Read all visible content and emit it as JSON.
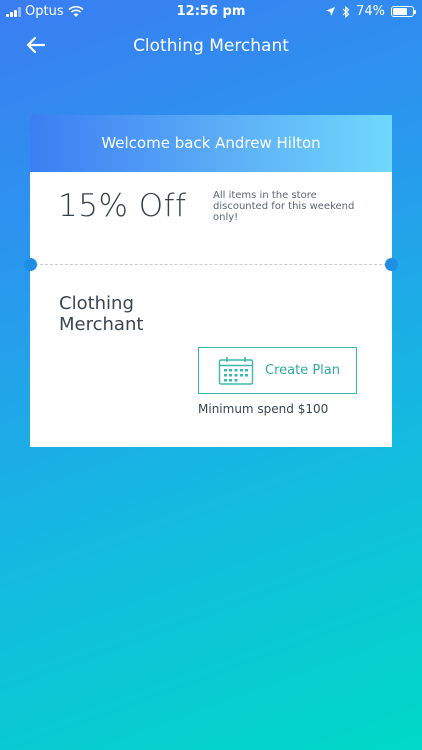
{
  "status_bar": {
    "carrier": "Optus",
    "time": "12:56 pm",
    "battery_percent": "74%",
    "battery_level": 0.74
  },
  "nav": {
    "title": "Clothing Merchant",
    "back_icon": "arrow-left-icon"
  },
  "card": {
    "welcome": "Welcome back Andrew Hilton",
    "offer_title": "15% Off",
    "offer_description": "All items in the store discounted for this weekend only!",
    "merchant_name_line1": "Clothing",
    "merchant_name_line2": "Merchant",
    "create_plan_label": "Create Plan",
    "create_plan_icon": "calendar-icon",
    "min_spend": "Minimum spend $100"
  },
  "colors": {
    "header_gradient_start": "#3c7ef3",
    "header_gradient_end": "#6fd8fb",
    "accent_teal": "#3bb8ae",
    "text_dark": "#35404c"
  }
}
